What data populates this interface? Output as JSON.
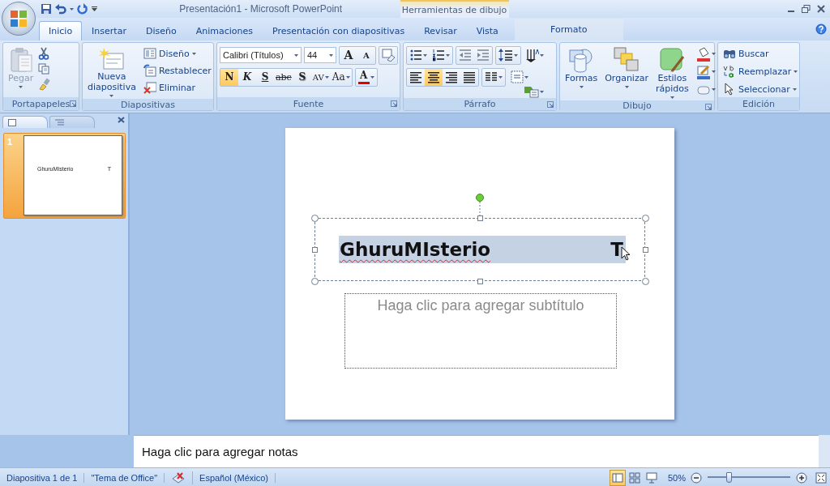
{
  "window": {
    "title": "Presentación1 - Microsoft PowerPoint",
    "contextual_label": "Herramientas de dibujo"
  },
  "tabs": [
    {
      "label": "Inicio",
      "selected": true,
      "kind": "normal"
    },
    {
      "label": "Insertar",
      "selected": false,
      "kind": "normal"
    },
    {
      "label": "Diseño",
      "selected": false,
      "kind": "normal"
    },
    {
      "label": "Animaciones",
      "selected": false,
      "kind": "normal"
    },
    {
      "label": "Presentación con diapositivas",
      "selected": false,
      "kind": "normal"
    },
    {
      "label": "Revisar",
      "selected": false,
      "kind": "normal"
    },
    {
      "label": "Vista",
      "selected": false,
      "kind": "normal"
    },
    {
      "label": "Formato",
      "selected": false,
      "kind": "contextual"
    }
  ],
  "clipboard": {
    "label": "Portapapeles",
    "paste": {
      "label": "Pegar",
      "disabled": true
    }
  },
  "slides_group": {
    "label": "Diapositivas",
    "new_slide": "Nueva diapositiva",
    "buttons": [
      "Diseño",
      "Restablecer",
      "Eliminar"
    ]
  },
  "font": {
    "label": "Fuente",
    "font_name": "Calibri (Títulos)",
    "font_size": "44",
    "grow": "A",
    "shrink": "A",
    "formats": [
      {
        "text": "N",
        "kind": "bold",
        "selected": true
      },
      {
        "text": "K",
        "kind": "italic",
        "selected": false
      },
      {
        "text": "S",
        "kind": "underline",
        "selected": false
      },
      {
        "text": "abc",
        "kind": "strike",
        "selected": false
      },
      {
        "text": "S",
        "kind": "shadow",
        "selected": false
      },
      {
        "text": "AV",
        "kind": "spacing",
        "selected": false
      },
      {
        "text": "Aa",
        "kind": "case",
        "selected": false
      }
    ],
    "color_button": "A"
  },
  "paragraph": {
    "label": "Párrafo",
    "alignments": [
      {
        "selected": false
      },
      {
        "selected": true
      },
      {
        "selected": false
      },
      {
        "selected": false
      }
    ]
  },
  "drawing": {
    "label": "Dibujo",
    "buttons": [
      "Formas",
      "Organizar",
      "Estilos rápidos"
    ]
  },
  "editing": {
    "label": "Edición",
    "buttons": [
      "Buscar",
      "Reemplazar",
      "Seleccionar"
    ]
  },
  "slide_pane": {
    "slides": [
      {
        "number": "1",
        "selected": true,
        "title": "GhuruMIsterio",
        "mark": "T"
      }
    ]
  },
  "slide": {
    "title": "GhuruMIsterio",
    "title_end": "T",
    "subtitle_placeholder": "Haga clic para agregar subtítulo"
  },
  "notes": {
    "prompt": "Haga clic para agregar notas"
  },
  "status_bar": {
    "slide_info": "Diapositiva 1 de 1",
    "theme": "\"Tema de Office\"",
    "language": "Español (México)",
    "views": [
      {
        "selected": true
      },
      {
        "selected": false
      },
      {
        "selected": false
      }
    ],
    "zoom": "50%",
    "level": 0.25
  }
}
